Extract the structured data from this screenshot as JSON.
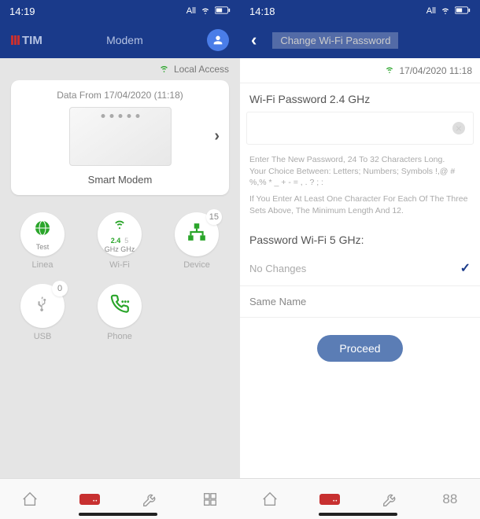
{
  "left": {
    "status": {
      "time": "14:19",
      "network_label": "All"
    },
    "header": {
      "brand": "TIM",
      "title": "Modem"
    },
    "local_access": "Local Access",
    "modem_card": {
      "data_from": "Data From 17/04/2020 (11:18)",
      "name": "Smart Modem"
    },
    "tiles": {
      "linea": {
        "label": "Linea",
        "sub": "Test"
      },
      "wifi": {
        "label": "Wi-Fi",
        "sub_24": "2.4",
        "sub_5": "5",
        "sub_line2": "GHz GHz"
      },
      "device": {
        "label": "Device",
        "badge": "15"
      },
      "usb": {
        "label": "USB",
        "badge": "0"
      },
      "phone": {
        "label": "Phone"
      }
    }
  },
  "right": {
    "status": {
      "time": "14:18",
      "network_label": "All"
    },
    "header": {
      "title": "Change Wi-Fi Password"
    },
    "refresh_time": "17/04/2020 11:18",
    "pwd24_label": "Wi-Fi Password 2.4 GHz",
    "hint_line1": "Enter The New Password, 24 To 32 Characters Long.",
    "hint_line2": "Your Choice Between: Letters; Numbers; Symbols !,@ # %,% * _ + - = , . ? ; :",
    "hint_line3": "If You Enter At Least One Character For Each Of The Three Sets Above, The Minimum Length And 12.",
    "pwd5_label": "Password Wi-Fi 5 GHz:",
    "no_changes": "No Changes",
    "same_name": "Same Name",
    "proceed": "Proceed"
  },
  "nav": {
    "num": "88"
  }
}
